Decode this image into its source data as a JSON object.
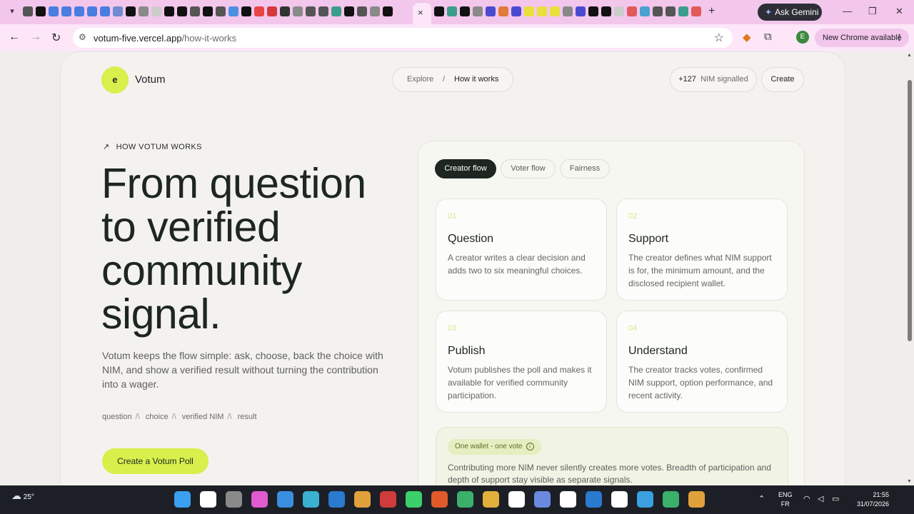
{
  "browser": {
    "new_tab_symbol": "+",
    "close_symbol": "×",
    "gemini_label": "Ask Gemini",
    "url_host": "votum-five.vercel.app",
    "url_path": "/how-it-works",
    "profile_initial": "E",
    "update_label": "New Chrome available",
    "window_min": "—",
    "window_restore": "❐",
    "window_close": "✕",
    "tab_icon_colors": [
      "#555",
      "#111",
      "#4a7de0",
      "#4a7de0",
      "#4a7de0",
      "#4a7de0",
      "#4a7de0",
      "#6f8bd1",
      "#111",
      "#8a8a8a",
      "#ccc",
      "#111",
      "#111",
      "#555",
      "#111",
      "#555",
      "#4a90e2",
      "#111",
      "#e84545",
      "#d53a3a",
      "#333",
      "#8a8a8a",
      "#555",
      "#555",
      "#3b9e8c",
      "#111",
      "#555",
      "#8a8a8a",
      "#111"
    ],
    "tab_icon_colors_right": [
      "#111",
      "#3b9e8c",
      "#111",
      "#8a8a8a",
      "#4a4ad0",
      "#e07b3b",
      "#4a4ad0",
      "#e8e13b",
      "#e8e13b",
      "#e8e13b",
      "#888",
      "#4a4ad0",
      "#111",
      "#111",
      "#ccc",
      "#e05a5a",
      "#4aa0d0",
      "#555",
      "#555",
      "#3b9e8c",
      "#e05a5a"
    ]
  },
  "site": {
    "logo_glyph": "e",
    "brand": "Votum",
    "nav": {
      "explore": "Explore",
      "separator": "/",
      "current": "How it works"
    },
    "signal": {
      "count": "+127",
      "label": "NIM signalled"
    },
    "create_label": "Create"
  },
  "hero": {
    "eyebrow": "HOW VOTUM WORKS",
    "title": "From question to verified community signal.",
    "lede": "Votum keeps the flow simple: ask, choose, back the choice with NIM, and show a verified result without turning the contribution into a wager.",
    "chips": [
      "question",
      "choice",
      "verified NIM",
      "result"
    ],
    "chip_separator": "/\\",
    "cta_label": "Create a Votum Poll"
  },
  "panel": {
    "tabs": [
      "Creator flow",
      "Voter flow",
      "Fairness"
    ],
    "active_tab": "Creator flow",
    "steps": [
      {
        "num": "01",
        "title": "Question",
        "body": "A creator writes a clear decision and adds two to six meaningful choices."
      },
      {
        "num": "02",
        "title": "Support",
        "body": "The creator defines what NIM support is for, the minimum amount, and the disclosed recipient wallet."
      },
      {
        "num": "03",
        "title": "Publish",
        "body": "Votum publishes the poll and makes it available for verified community participation."
      },
      {
        "num": "04",
        "title": "Understand",
        "body": "The creator tracks votes, confirmed NIM support, option performance, and recent activity."
      }
    ],
    "note": {
      "tag": "One wallet - one vote",
      "text": "Contributing more NIM never silently creates more votes. Breadth of participation and depth of support stay visible as separate signals."
    }
  },
  "taskbar": {
    "temperature": "25°",
    "lang_top": "ENG",
    "lang_bottom": "FR",
    "time": "21:55",
    "date": "31/07/2026",
    "app_colors": [
      "#3aa0f0",
      "#ffffff",
      "#8a8a8a",
      "#e05ad0",
      "#3a8ee0",
      "#3bb0d0",
      "#2a7ad0",
      "#e0a03b",
      "#d03b3b",
      "#3bd06a",
      "#e05a2a",
      "#3bb06a",
      "#e0b03b",
      "#ffffff",
      "#6a8ae0",
      "#ffffff",
      "#2a7ad0",
      "#ffffff",
      "#3aa0e0",
      "#3bb06a",
      "#e0a03b"
    ]
  }
}
